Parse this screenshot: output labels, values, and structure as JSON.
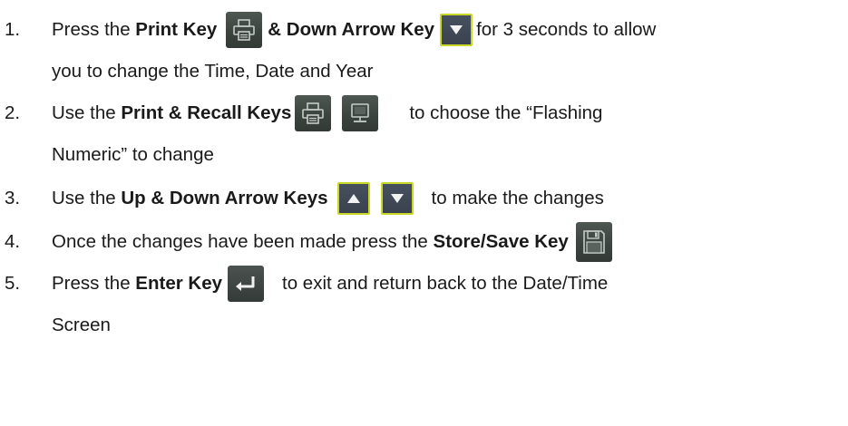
{
  "steps": [
    {
      "number": "1.",
      "t1": "Press the ",
      "b1": "Print Key",
      "b2": "& Down Arrow Key",
      "t2": "for 3 seconds to allow",
      "t3": "you to change the Time, Date and Year"
    },
    {
      "number": "2.",
      "t1": "Use the ",
      "b1": "Print & Recall Keys",
      "t2": "to choose the “Flashing",
      "t3": "Numeric” to change"
    },
    {
      "number": "3.",
      "t1": "Use the ",
      "b1": "Up & Down Arrow Keys",
      "t2": "to make the changes"
    },
    {
      "number": "4.",
      "t1": "Once the changes have been made press the ",
      "b1": "Store/Save Key"
    },
    {
      "number": "5.",
      "t1": "Press the ",
      "b1": "Enter Key",
      "t2": "to exit and return back to the Date/Time",
      "t3": "Screen"
    }
  ],
  "icons": {
    "print": "printer-icon",
    "recall": "monitor-icon",
    "up": "up-arrow-icon",
    "down": "down-arrow-icon",
    "save": "floppy-disk-icon",
    "enter": "enter-return-icon"
  },
  "colors": {
    "key_fill": "#3c443f",
    "arrow_key_fill": "#3a4250",
    "arrow_highlight": "#c9d72a"
  }
}
